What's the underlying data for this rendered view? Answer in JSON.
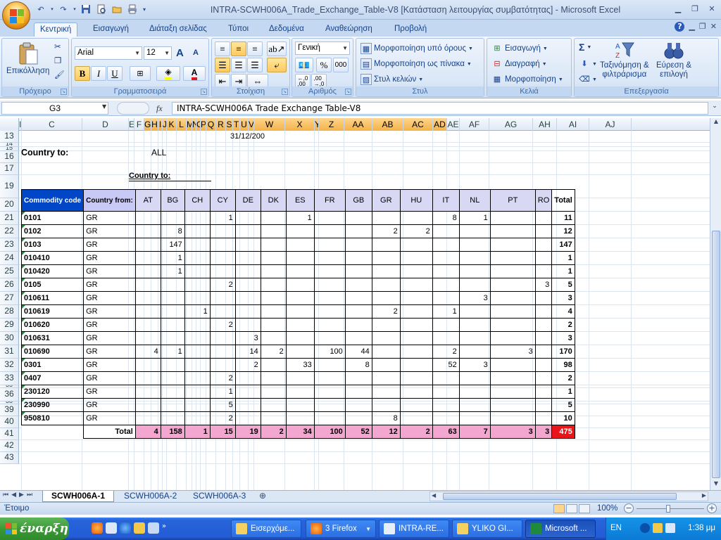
{
  "window": {
    "title": "INTRA-SCWH006A_Trade_Exchange_Table-V8  [Κατάσταση λειτουργίας συμβατότητας] - Microsoft Excel",
    "controls": [
      "minimize",
      "restore",
      "close"
    ]
  },
  "quick_access": [
    "undo",
    "redo",
    "save",
    "print-preview",
    "open",
    "print"
  ],
  "ribbon": {
    "tabs": [
      "Κεντρική",
      "Εισαγωγή",
      "Διάταξη σελίδας",
      "Τύποι",
      "Δεδομένα",
      "Αναθεώρηση",
      "Προβολή"
    ],
    "active_tab": "Κεντρική",
    "groups": {
      "clipboard": {
        "label": "Πρόχειρο",
        "paste": "Επικόλληση"
      },
      "font": {
        "label": "Γραμματοσειρά",
        "font_name": "Arial",
        "font_size": "12",
        "bold": "B",
        "italic": "I",
        "underline": "U",
        "grow": "A",
        "shrink": "A",
        "font_color": "A"
      },
      "alignment": {
        "label": "Στοίχιση"
      },
      "number": {
        "label": "Αριθμός",
        "format": "Γενική",
        "percent": "%",
        "thousands": "000",
        "inc_decimal": "←,0\n,00",
        "dec_decimal": ",00\n→,0"
      },
      "styles": {
        "label": "Στυλ",
        "conditional": "Μορφοποίηση υπό όρους",
        "as_table": "Μορφοποίηση ως πίνακα",
        "cell_styles": "Στυλ κελιών"
      },
      "cells": {
        "label": "Κελιά",
        "insert": "Εισαγωγή",
        "delete": "Διαγραφή",
        "format": "Μορφοποίηση"
      },
      "editing": {
        "label": "Επεξεργασία",
        "sum": "Σ",
        "sort_filter": "Ταξινόμηση &\nφιλτράρισμα",
        "find_select": "Εύρεση &\nεπιλογή"
      }
    }
  },
  "formula_bar": {
    "name_box": "G3",
    "fx": "fx",
    "content": "INTRA-SCWH006A Trade Exchange Table-V8"
  },
  "sheet": {
    "columns": [
      "I",
      "C",
      "D",
      "E",
      "F",
      "G",
      "H",
      "I",
      "J",
      "K",
      "L",
      "M",
      "N",
      "O",
      "P",
      "Q",
      "R",
      "S",
      "T",
      "U",
      "V",
      "W",
      "X",
      "Y",
      "Z",
      "AA",
      "AB",
      "AC",
      "AD",
      "AE",
      "AF",
      "AG",
      "AH",
      "AI",
      "AJ"
    ],
    "selected_columns": [
      "G",
      "H",
      "I",
      "J",
      "K",
      "L",
      "M",
      "N",
      "O",
      "P",
      "Q",
      "R",
      "S",
      "T",
      "U",
      "V",
      "W",
      "X",
      "Y",
      "Z",
      "AA",
      "AB",
      "AC",
      "AD"
    ],
    "rows": [
      "13",
      "14",
      "15",
      "16",
      "17",
      "19",
      "20",
      "21",
      "22",
      "23",
      "24",
      "25",
      "26",
      "27",
      "28",
      "29",
      "30",
      "31",
      "32",
      "33",
      "35",
      "36",
      "38",
      "39",
      "40",
      "41",
      "42",
      "43"
    ],
    "date": "31/12/200",
    "country_to_label": "Country to:",
    "country_to_value": "ALL",
    "country_to_sub": "Country to:",
    "table": {
      "header_code": "Commodity code",
      "header_from": "Country from:",
      "countries": [
        "AT",
        "BG",
        "CH",
        "CY",
        "DE",
        "DK",
        "ES",
        "FR",
        "GB",
        "GR",
        "HU",
        "IT",
        "NL",
        "PT",
        "RO"
      ],
      "header_total": "Total",
      "rows": [
        {
          "code": "0101",
          "from": "GR",
          "values": [
            "",
            "",
            "",
            "1",
            "",
            "",
            "1",
            "",
            "",
            "",
            "",
            "8",
            "1",
            "",
            ""
          ],
          "total": "11"
        },
        {
          "code": "0102",
          "from": "GR",
          "values": [
            "",
            "8",
            "",
            "",
            "",
            "",
            "",
            "",
            "",
            "2",
            "2",
            "",
            "",
            "",
            ""
          ],
          "total": "12"
        },
        {
          "code": "0103",
          "from": "GR",
          "values": [
            "",
            "147",
            "",
            "",
            "",
            "",
            "",
            "",
            "",
            "",
            "",
            "",
            "",
            "",
            ""
          ],
          "total": "147"
        },
        {
          "code": "010410",
          "from": "GR",
          "values": [
            "",
            "1",
            "",
            "",
            "",
            "",
            "",
            "",
            "",
            "",
            "",
            "",
            "",
            "",
            ""
          ],
          "total": "1"
        },
        {
          "code": "010420",
          "from": "GR",
          "values": [
            "",
            "1",
            "",
            "",
            "",
            "",
            "",
            "",
            "",
            "",
            "",
            "",
            "",
            "",
            ""
          ],
          "total": "1"
        },
        {
          "code": "0105",
          "from": "GR",
          "values": [
            "",
            "",
            "",
            "2",
            "",
            "",
            "",
            "",
            "",
            "",
            "",
            "",
            "",
            "",
            "3"
          ],
          "total": "5"
        },
        {
          "code": "010611",
          "from": "GR",
          "values": [
            "",
            "",
            "",
            "",
            "",
            "",
            "",
            "",
            "",
            "",
            "",
            "",
            "3",
            "",
            ""
          ],
          "total": "3"
        },
        {
          "code": "010619",
          "from": "GR",
          "values": [
            "",
            "",
            "1",
            "",
            "",
            "",
            "",
            "",
            "",
            "2",
            "",
            "1",
            "",
            "",
            ""
          ],
          "total": "4"
        },
        {
          "code": "010620",
          "from": "GR",
          "values": [
            "",
            "",
            "",
            "2",
            "",
            "",
            "",
            "",
            "",
            "",
            "",
            "",
            "",
            "",
            ""
          ],
          "total": "2"
        },
        {
          "code": "010631",
          "from": "GR",
          "values": [
            "",
            "",
            "",
            "",
            "3",
            "",
            "",
            "",
            "",
            "",
            "",
            "",
            "",
            "",
            ""
          ],
          "total": "3"
        },
        {
          "code": "010690",
          "from": "GR",
          "values": [
            "4",
            "1",
            "",
            "",
            "14",
            "2",
            "",
            "100",
            "44",
            "",
            "",
            "2",
            "",
            "3",
            ""
          ],
          "total": "170"
        },
        {
          "code": "0301",
          "from": "GR",
          "values": [
            "",
            "",
            "",
            "",
            "2",
            "",
            "33",
            "",
            "8",
            "",
            "",
            "52",
            "3",
            "",
            ""
          ],
          "total": "98"
        },
        {
          "code": "0407",
          "from": "GR",
          "values": [
            "",
            "",
            "",
            "2",
            "",
            "",
            "",
            "",
            "",
            "",
            "",
            "",
            "",
            "",
            ""
          ],
          "total": "2"
        },
        {
          "code": "230120",
          "from": "GR",
          "values": [
            "",
            "",
            "",
            "1",
            "",
            "",
            "",
            "",
            "",
            "",
            "",
            "",
            "",
            "",
            ""
          ],
          "total": "1"
        },
        {
          "code": "230990",
          "from": "GR",
          "values": [
            "",
            "",
            "",
            "5",
            "",
            "",
            "",
            "",
            "",
            "",
            "",
            "",
            "",
            "",
            ""
          ],
          "total": "5"
        },
        {
          "code": "950810",
          "from": "GR",
          "values": [
            "",
            "",
            "",
            "2",
            "",
            "",
            "",
            "",
            "",
            "8",
            "",
            "",
            "",
            "",
            ""
          ],
          "total": "10"
        }
      ],
      "total_label": "Total",
      "totals": [
        "4",
        "158",
        "1",
        "15",
        "19",
        "2",
        "34",
        "100",
        "52",
        "12",
        "2",
        "63",
        "7",
        "3",
        "3"
      ],
      "grand_total": "475"
    }
  },
  "sheet_tabs": [
    "SCWH006A-1",
    "SCWH006A-2",
    "SCWH006A-3"
  ],
  "active_sheet": "SCWH006A-1",
  "status": {
    "ready": "Έτοιμο",
    "zoom": "100%"
  },
  "taskbar": {
    "start": "έναρξη",
    "tasks": [
      "Εισερχόμε...",
      "3 Firefox",
      "INTRA-RE...",
      "YLIKO GI...",
      "Microsoft ..."
    ],
    "active_task": "Microsoft ...",
    "language": "EN",
    "clock": "1:38 μμ"
  },
  "colors": {
    "header_code_bg": "#0046c7",
    "header_from_bg": "#c9c9f5",
    "total_row_bg": "#f3a6cf",
    "grand_total_bg": "#e8161b",
    "selected_col_bg": "#f3b248"
  }
}
